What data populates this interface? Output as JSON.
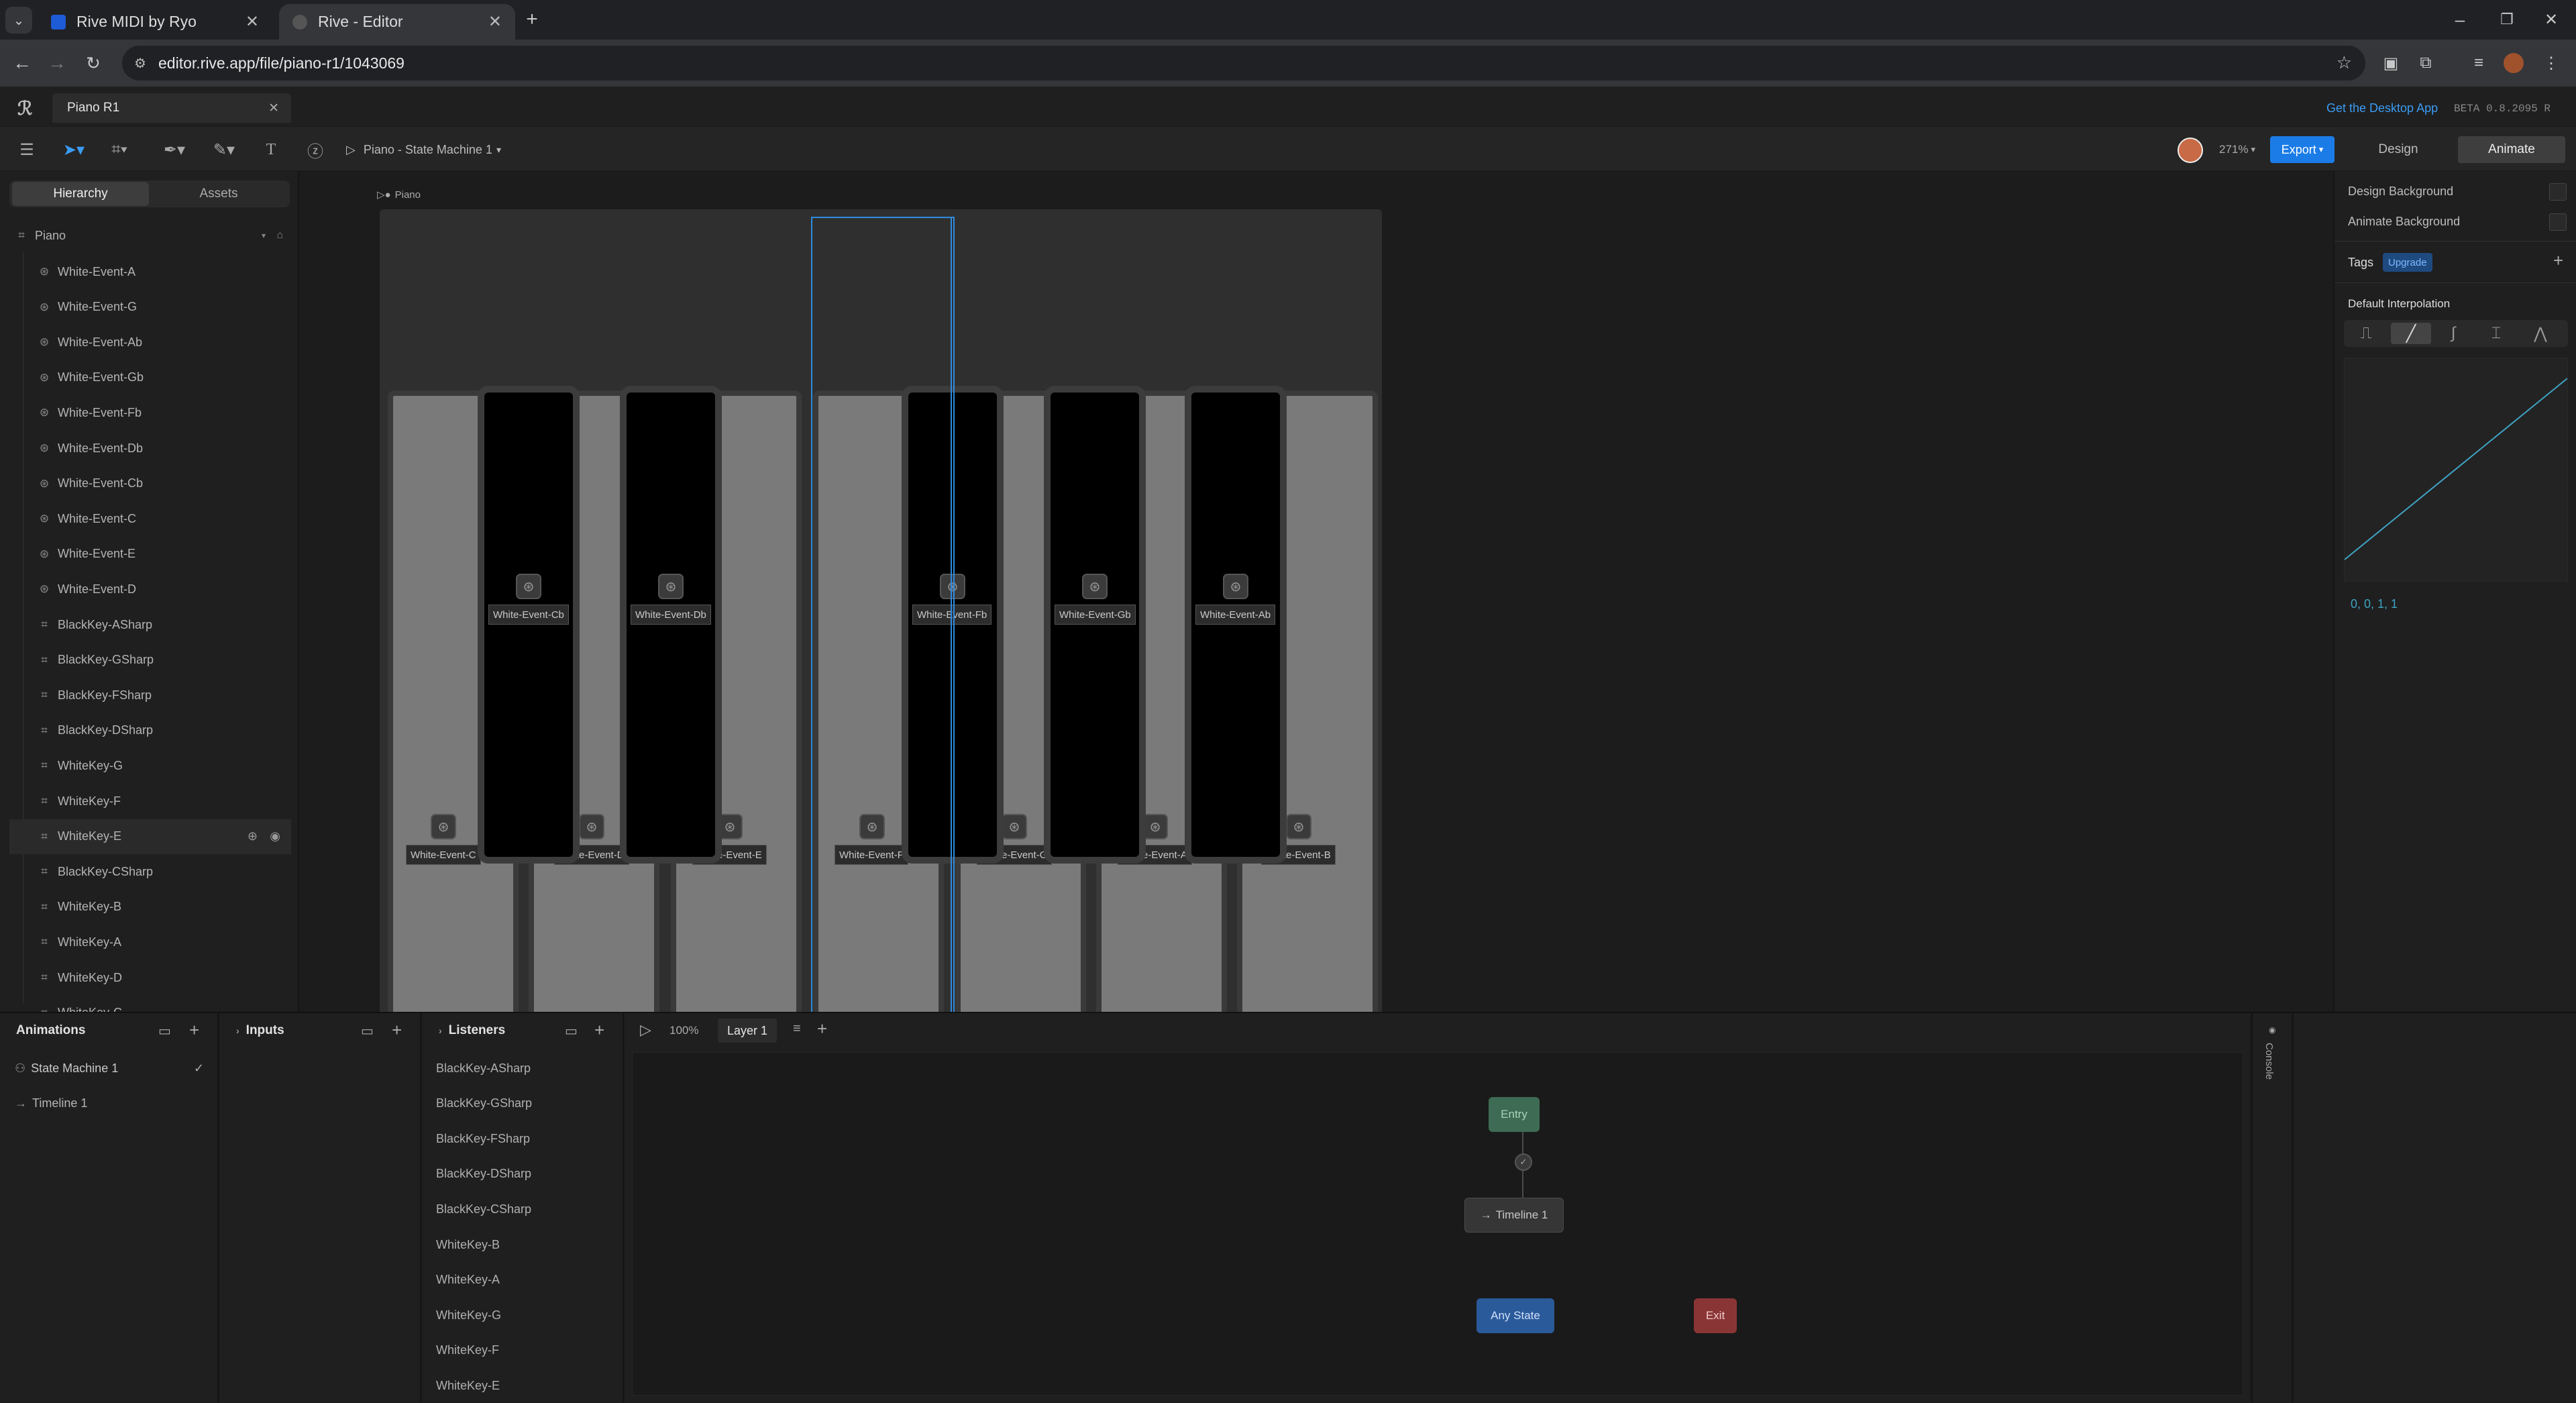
{
  "browser": {
    "tabs": [
      {
        "title": "Rive MIDI by Ryo"
      },
      {
        "title": "Rive - Editor"
      }
    ],
    "url": "editor.rive.app/file/piano-r1/1043069"
  },
  "file_tab": {
    "title": "Piano R1"
  },
  "header_right": {
    "desktop_link": "Get the Desktop App",
    "version": "BETA 0.8.2095 R"
  },
  "toolbar": {
    "play_label": "Piano - State Machine 1",
    "zoom": "271%",
    "export_label": "Export",
    "design_tab": "Design",
    "animate_tab": "Animate"
  },
  "left_panel": {
    "tabs": [
      "Hierarchy",
      "Assets"
    ],
    "root": "Piano",
    "items": [
      {
        "label": "White-Event-A",
        "type": "event"
      },
      {
        "label": "White-Event-G",
        "type": "event"
      },
      {
        "label": "White-Event-Ab",
        "type": "event"
      },
      {
        "label": "White-Event-Gb",
        "type": "event"
      },
      {
        "label": "White-Event-Fb",
        "type": "event"
      },
      {
        "label": "White-Event-Db",
        "type": "event"
      },
      {
        "label": "White-Event-Cb",
        "type": "event"
      },
      {
        "label": "White-Event-C",
        "type": "event"
      },
      {
        "label": "White-Event-E",
        "type": "event"
      },
      {
        "label": "White-Event-D",
        "type": "event"
      },
      {
        "label": "BlackKey-ASharp",
        "type": "group"
      },
      {
        "label": "BlackKey-GSharp",
        "type": "group"
      },
      {
        "label": "BlackKey-FSharp",
        "type": "group"
      },
      {
        "label": "BlackKey-DSharp",
        "type": "group"
      },
      {
        "label": "WhiteKey-G",
        "type": "group"
      },
      {
        "label": "WhiteKey-F",
        "type": "group"
      },
      {
        "label": "WhiteKey-E",
        "type": "group"
      },
      {
        "label": "BlackKey-CSharp",
        "type": "group"
      },
      {
        "label": "WhiteKey-B",
        "type": "group"
      },
      {
        "label": "WhiteKey-A",
        "type": "group"
      },
      {
        "label": "WhiteKey-D",
        "type": "group"
      },
      {
        "label": "WhiteKey-C",
        "type": "group"
      }
    ]
  },
  "canvas": {
    "artboard_label": "Piano",
    "white_key_events": [
      "White-Event-C",
      "White-Event-D",
      "White-Event-E",
      "White-Event-F",
      "White-Event-G",
      "White-Event-A",
      "White-Event-B"
    ],
    "black_key_events": [
      "White-Event-Cb",
      "White-Event-Db",
      "White-Event-Fb",
      "White-Event-Gb",
      "White-Event-Ab"
    ]
  },
  "right_panel": {
    "design_background": "Design Background",
    "animate_background": "Animate Background",
    "tags_label": "Tags",
    "upgrade_badge": "Upgrade",
    "interp_title": "Default Interpolation",
    "interp_values": "0, 0, 1, 1",
    "curve_color": "#3fa3c4"
  },
  "bottom": {
    "animations": {
      "title": "Animations",
      "items": [
        "State Machine 1",
        "Timeline 1"
      ]
    },
    "inputs": {
      "title": "Inputs"
    },
    "listeners": {
      "title": "Listeners",
      "items": [
        "BlackKey-ASharp",
        "BlackKey-GSharp",
        "BlackKey-FSharp",
        "BlackKey-DSharp",
        "BlackKey-CSharp",
        "WhiteKey-B",
        "WhiteKey-A",
        "WhiteKey-G",
        "WhiteKey-F",
        "WhiteKey-E"
      ]
    },
    "graph": {
      "zoom": "100%",
      "layer": "Layer 1",
      "entry": "Entry",
      "timeline": "Timeline 1",
      "any_state": "Any State",
      "exit": "Exit"
    },
    "console": "Console"
  }
}
